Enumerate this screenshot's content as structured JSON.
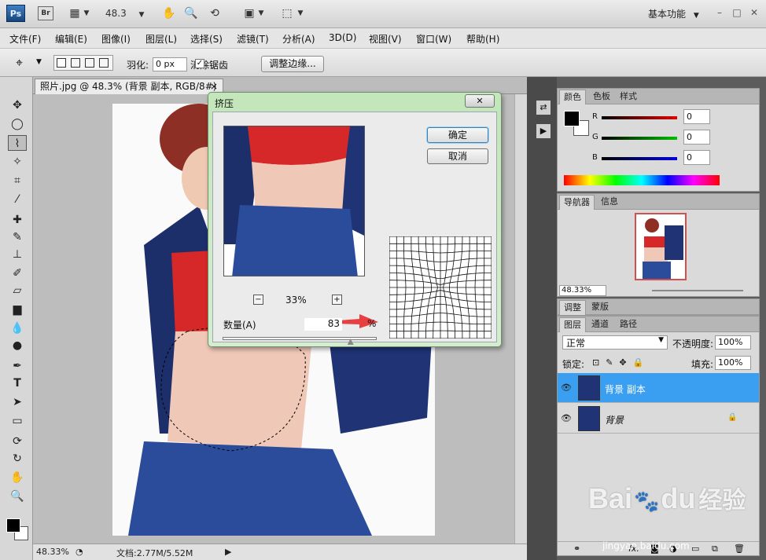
{
  "app": {
    "logo": "Ps",
    "bridge": "Br",
    "zoom": "48.3",
    "workspace": "基本功能",
    "window_buttons": [
      "–",
      "□",
      "✕"
    ]
  },
  "menu": [
    "文件(F)",
    "编辑(E)",
    "图像(I)",
    "图层(L)",
    "选择(S)",
    "滤镜(T)",
    "分析(A)",
    "3D(D)",
    "视图(V)",
    "窗口(W)",
    "帮助(H)"
  ],
  "options": {
    "feather_label": "羽化:",
    "feather_value": "0 px",
    "antialias_label": "消除锯齿",
    "antialias_checked": true,
    "refine_button": "调整边缘..."
  },
  "document": {
    "tab_title": "照片.jpg @ 48.3% (背景 副本, RGB/8#) *",
    "tab_close": "×",
    "status_zoom": "48.33%",
    "status_doc": "文档:2.77M/5.52M"
  },
  "dialog": {
    "title": "挤压",
    "ok": "确定",
    "cancel": "取消",
    "preview_zoom": "33%",
    "amount_label": "数量(A)",
    "amount_value": "83",
    "amount_unit": "%",
    "amount_fraction": 0.83,
    "minus": "−",
    "plus": "+"
  },
  "color_panel": {
    "tabs": [
      "颜色",
      "色板",
      "样式"
    ],
    "channels": [
      {
        "label": "R",
        "value": "0",
        "color": "#d01010"
      },
      {
        "label": "G",
        "value": "0",
        "color": "#10a010"
      },
      {
        "label": "B",
        "value": "0",
        "color": "#1010d0"
      }
    ]
  },
  "navigator": {
    "tabs": [
      "导航器",
      "信息"
    ],
    "zoom": "48.33%"
  },
  "adjust_panel": {
    "tabs": [
      "调整",
      "蒙版"
    ]
  },
  "layers_panel": {
    "tabs": [
      "图层",
      "通道",
      "路径"
    ],
    "blend_mode": "正常",
    "opacity_label": "不透明度:",
    "opacity": "100%",
    "lock_label": "锁定:",
    "fill_label": "填充:",
    "fill": "100%",
    "layers": [
      {
        "name": "背景 副本",
        "selected": true
      },
      {
        "name": "背景",
        "selected": false,
        "locked": true
      }
    ],
    "footer_icons": [
      "link-icon",
      "fx-icon",
      "mask-icon",
      "adjustment-icon",
      "group-icon",
      "new-layer-icon",
      "trash-icon"
    ],
    "footer_fx": "fx."
  },
  "watermark": {
    "brand": "Bai",
    "brand2": "du",
    "suffix": "经验",
    "url": "jingyan.baidu.com"
  }
}
